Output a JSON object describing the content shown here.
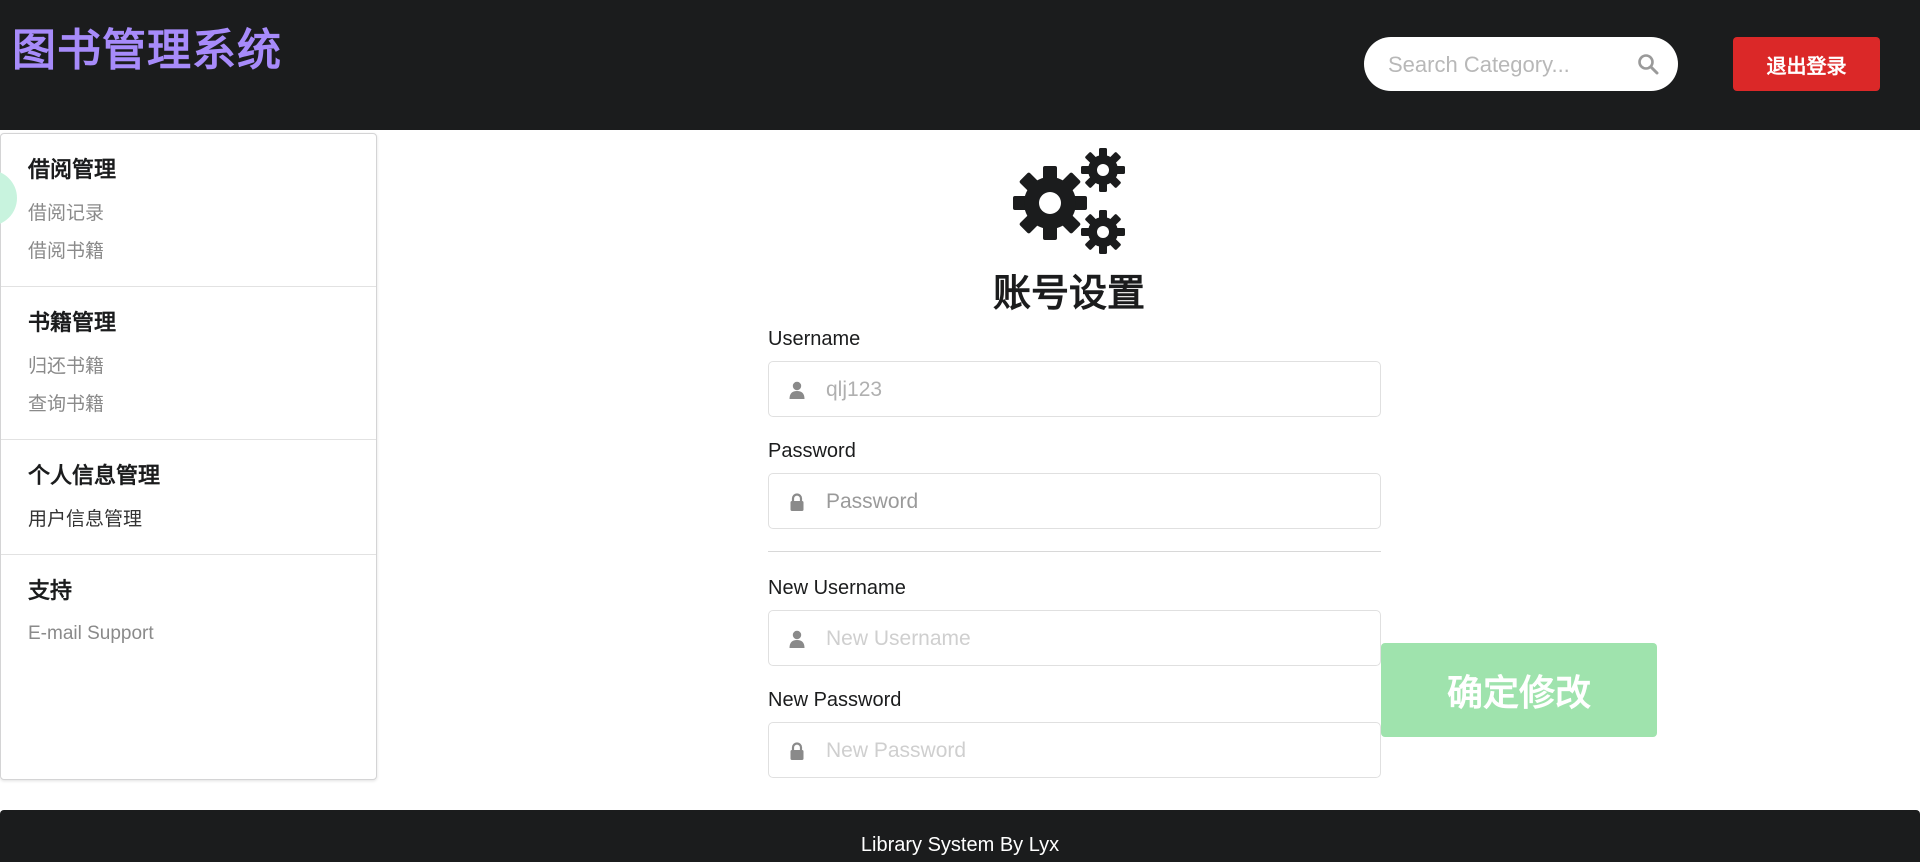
{
  "header": {
    "brand": "图书管理系统",
    "search_placeholder": "Search Category...",
    "search_icon": "search-icon",
    "logout_label": "退出登录"
  },
  "sidebar": {
    "groups": [
      {
        "title": "借阅管理",
        "items": [
          {
            "label": "借阅记录"
          },
          {
            "label": "借阅书籍"
          }
        ]
      },
      {
        "title": "书籍管理",
        "items": [
          {
            "label": "归还书籍"
          },
          {
            "label": "查询书籍"
          }
        ]
      },
      {
        "title": "个人信息管理",
        "items": [
          {
            "label": "用户信息管理"
          }
        ]
      },
      {
        "title": "支持",
        "items": [
          {
            "label": "E-mail Support"
          }
        ]
      }
    ]
  },
  "settings": {
    "icon": "gears-icon",
    "title": "账号设置",
    "username_label": "Username",
    "username_value": "qlj123",
    "password_label": "Password",
    "password_placeholder": "Password",
    "new_username_label": "New Username",
    "new_username_placeholder": "New Username",
    "new_password_label": "New Password",
    "new_password_placeholder": "New Password",
    "confirm_label": "确定修改"
  },
  "footer": {
    "text": "Library System By Lyx"
  },
  "colors": {
    "header_bg": "#1b1c1d",
    "brand": "#a78bfa",
    "logout": "#db2828",
    "confirm": "#9fe3ad"
  }
}
